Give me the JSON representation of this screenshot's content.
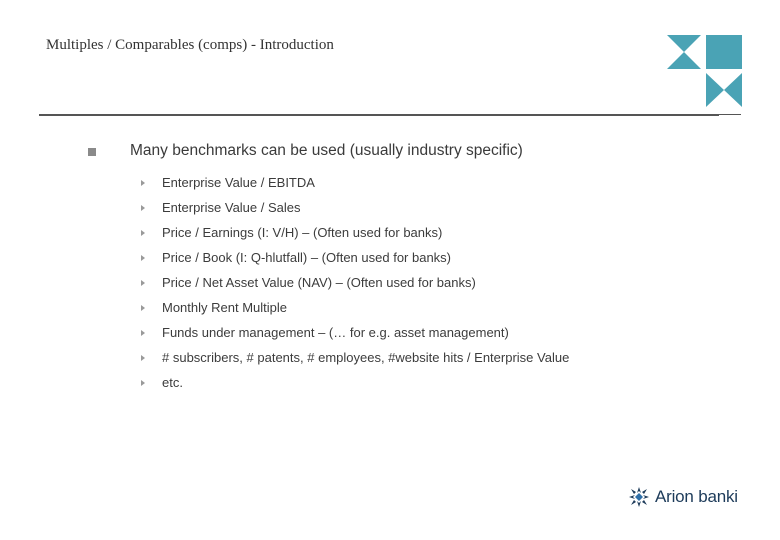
{
  "header": {
    "title": "Multiples / Comparables (comps) - Introduction"
  },
  "content": {
    "main_bullet": "Many benchmarks can be used (usually industry specific)",
    "sub_items": [
      "Enterprise Value / EBITDA",
      "Enterprise Value / Sales",
      "Price / Earnings (I: V/H) – (Often used for banks)",
      "Price / Book (I: Q-hlutfall) – (Often used for banks)",
      "Price / Net Asset Value (NAV) – (Often used for banks)",
      "Monthly Rent Multiple",
      "Funds under management – (… for e.g. asset management)",
      "# subscribers, # patents, # employees, #website hits / Enterprise Value",
      "etc."
    ]
  },
  "branding": {
    "logo_text": "Arion banki",
    "logo_icon": "star-icon",
    "accent_color": "#4aa3b5",
    "logo_color": "#1d3b5a"
  }
}
